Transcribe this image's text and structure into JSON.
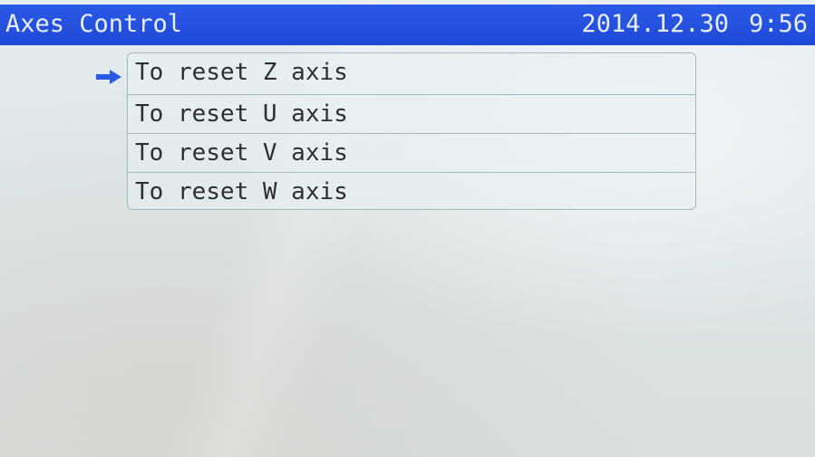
{
  "header": {
    "title": "Axes Control",
    "date": "2014.12.30",
    "time": "9:56"
  },
  "menu": {
    "selected_index": 0,
    "items": [
      {
        "label": "To reset Z axis"
      },
      {
        "label": "To reset U axis"
      },
      {
        "label": "To reset V axis"
      },
      {
        "label": "To reset W axis"
      }
    ]
  },
  "colors": {
    "titlebar": "#2350e0",
    "title_text": "#e8eeff",
    "selection_arrow": "#2a5ae6",
    "menu_text": "#2c2f33",
    "screen_bg": "#e0e8eb"
  },
  "icons": {
    "selection": "right-arrow-icon"
  }
}
